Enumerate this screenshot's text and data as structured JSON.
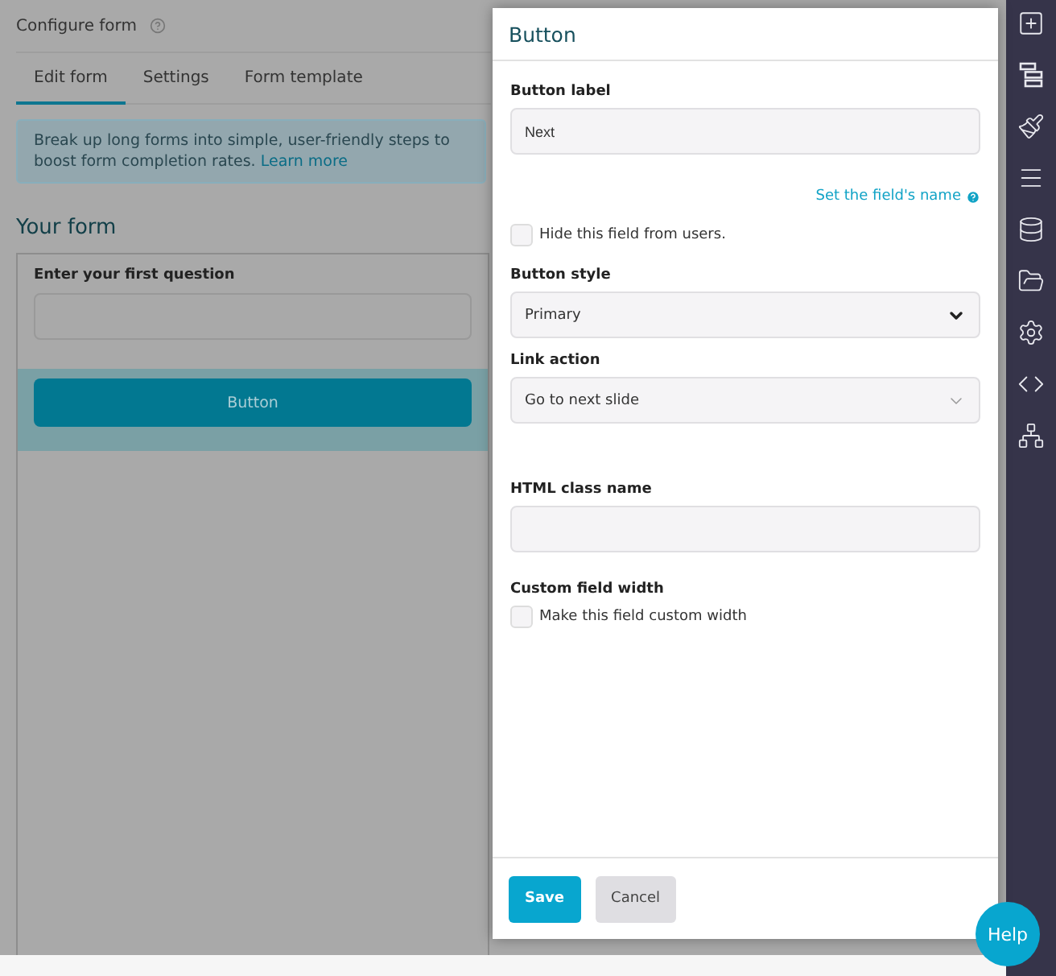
{
  "page": {
    "title": "Configure form",
    "tabs": [
      {
        "label": "Edit form",
        "selected": true
      },
      {
        "label": "Settings",
        "selected": false
      },
      {
        "label": "Form template",
        "selected": false
      }
    ],
    "notice": {
      "text": "Break up long forms into simple, user-friendly steps to boost form completion rates.",
      "link": "Learn more"
    },
    "section_title": "Your form",
    "form": {
      "question_label": "Enter your first question",
      "button_label": "Button"
    }
  },
  "dialog": {
    "title": "Button",
    "fields": [
      {
        "kind": "text",
        "label": "Button label",
        "value": "Next"
      },
      {
        "kind": "link",
        "text": "Set the field's name"
      },
      {
        "kind": "checkbox",
        "text": "Hide this field from users.",
        "checked": false
      },
      {
        "kind": "select",
        "label": "Button style",
        "value": "Primary"
      },
      {
        "kind": "select-light",
        "label": "Link action",
        "value": "Go to next slide"
      },
      {
        "kind": "text",
        "label": "HTML class name"
      },
      {
        "kind": "checkbox-group",
        "label": "Custom field width",
        "text": "Make this field custom width",
        "checked": false
      }
    ],
    "buttons": [
      {
        "label": "Save",
        "kind": "primary"
      },
      {
        "label": "Cancel",
        "kind": "secondary"
      }
    ]
  },
  "help": "Help"
}
